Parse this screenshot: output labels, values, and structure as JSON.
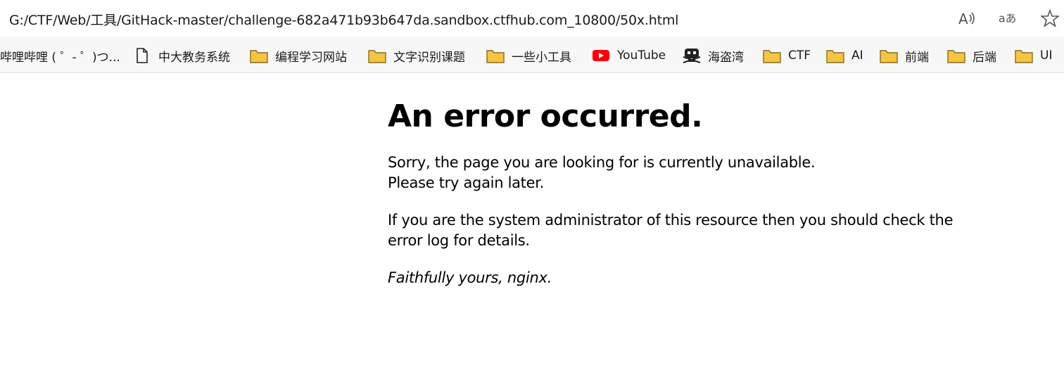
{
  "address_bar": {
    "url": "G:/CTF/Web/工具/GitHack-master/challenge-682a471b93b647da.sandbox.ctfhub.com_10800/50x.html",
    "icons": [
      "read-aloud-icon",
      "translate-icon",
      "favorite-star-icon"
    ]
  },
  "bookmarks": [
    {
      "label": "哔哩哔哩 ( ゜- ゜)つ...",
      "icon": "none"
    },
    {
      "label": "中大教务系统",
      "icon": "page-icon"
    },
    {
      "label": "编程学习网站",
      "icon": "folder-icon"
    },
    {
      "label": "文字识别课题",
      "icon": "folder-icon"
    },
    {
      "label": "一些小工具",
      "icon": "folder-icon"
    },
    {
      "label": "YouTube",
      "icon": "youtube-icon"
    },
    {
      "label": "海盗湾",
      "icon": "pirate-icon"
    },
    {
      "label": "CTF",
      "icon": "folder-icon"
    },
    {
      "label": "AI",
      "icon": "folder-icon"
    },
    {
      "label": "前端",
      "icon": "folder-icon"
    },
    {
      "label": "后端",
      "icon": "folder-icon"
    },
    {
      "label": "UI",
      "icon": "folder-icon"
    }
  ],
  "page": {
    "heading": "An error occurred.",
    "line1": "Sorry, the page you are looking for is currently unavailable.",
    "line2": "Please try again later.",
    "line3": "If you are the system administrator of this resource then you should check the",
    "line4": "error log for details.",
    "signature": "Faithfully yours, nginx."
  },
  "colors": {
    "folder": "#f5c542",
    "youtube": "#ff0000",
    "bookmarks_bg": "#f7f7f7"
  }
}
